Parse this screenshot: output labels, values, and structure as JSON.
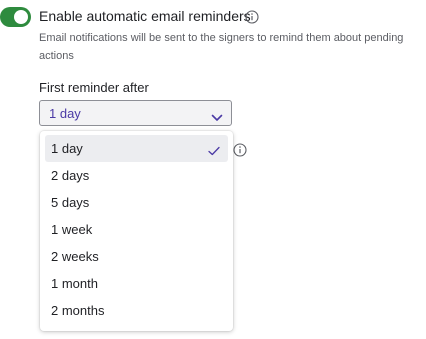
{
  "reminders": {
    "toggle_on": true,
    "toggle_color": "#2e8b3e",
    "title": "Enable automatic email reminders",
    "description": "Email notifications will be sent to the signers to remind them about pending actions",
    "first_reminder": {
      "label": "First reminder after",
      "selected_value": "1 day",
      "options": [
        "1 day",
        "2 days",
        "5 days",
        "1 week",
        "2 weeks",
        "1 month",
        "2 months"
      ],
      "selected_index": 0
    }
  },
  "icons": {
    "title_info": "info-icon",
    "hidden_field_info": "info-icon",
    "select_chevron": "chevron-down-icon",
    "selected_check": "check-icon"
  },
  "colors": {
    "accent_text": "#4b3aa5",
    "selected_option_bg": "#ecedf0"
  }
}
